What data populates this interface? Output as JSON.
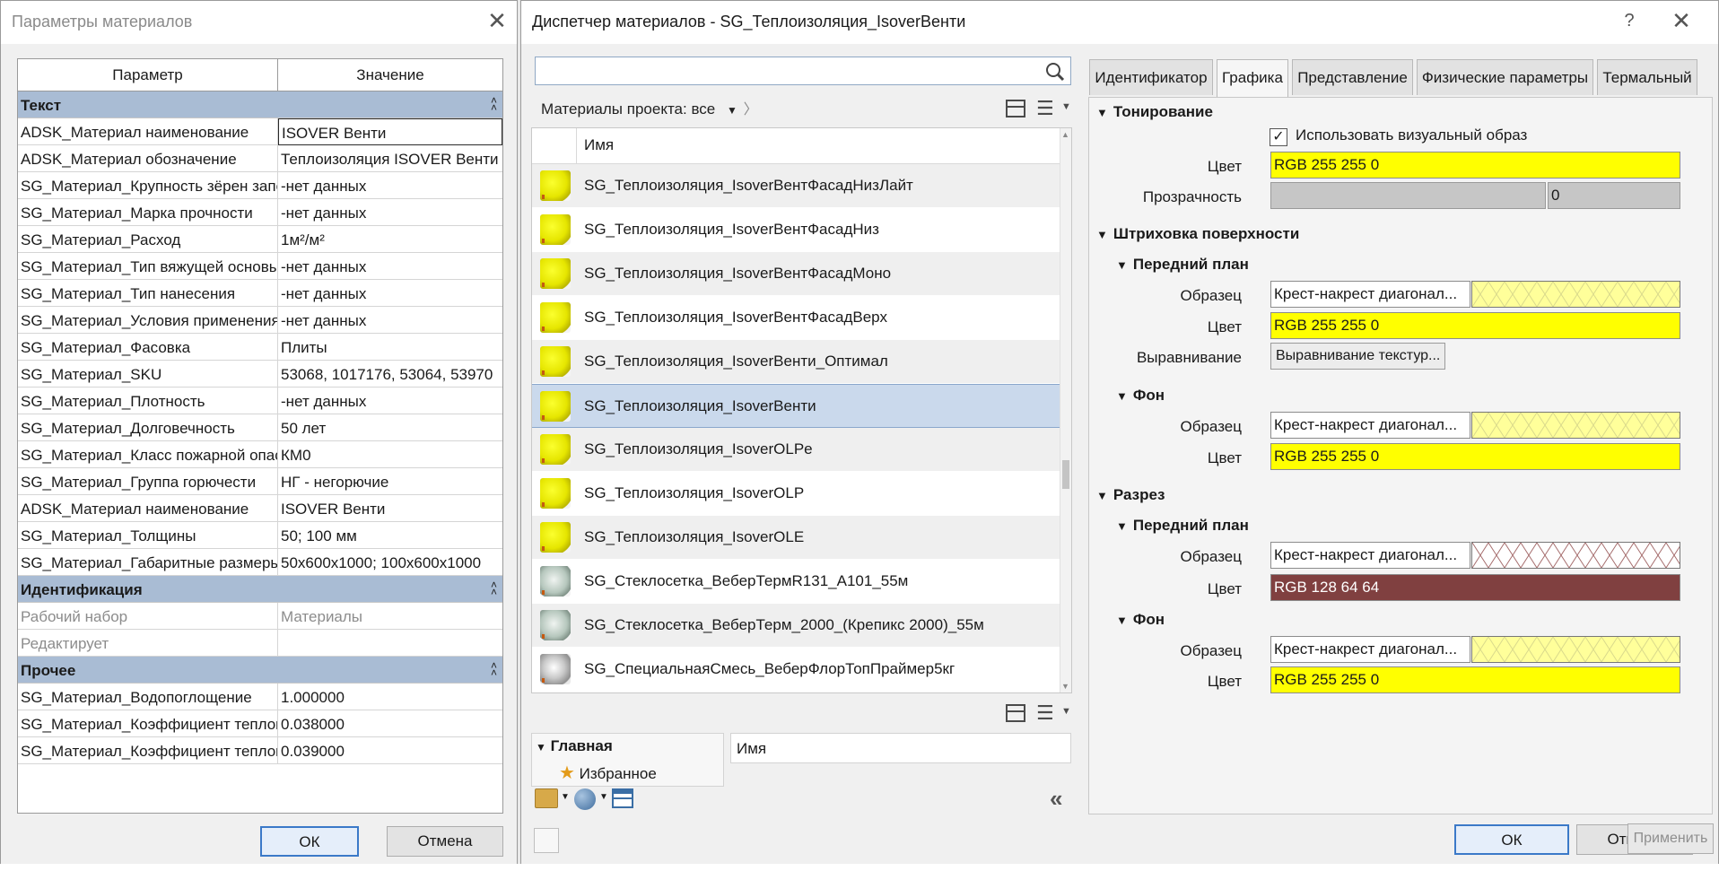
{
  "left_dialog": {
    "title": "Параметры материалов",
    "columns": [
      "Параметр",
      "Значение"
    ],
    "groups": [
      {
        "name": "Текст",
        "rows": [
          {
            "k": "ADSK_Материал наименование",
            "v": "ISOVER Венти"
          },
          {
            "k": "ADSK_Материал обозначение",
            "v": "Теплоизоляция ISOVER Венти"
          },
          {
            "k": "SG_Материал_Крупность зёрен запол",
            "v": "-нет данных"
          },
          {
            "k": "SG_Материал_Марка прочности",
            "v": "-нет данных"
          },
          {
            "k": "SG_Материал_Расход",
            "v": "1м²/м²"
          },
          {
            "k": "SG_Материал_Тип вяжущей основы",
            "v": "-нет данных"
          },
          {
            "k": "SG_Материал_Тип нанесения",
            "v": "-нет данных"
          },
          {
            "k": "SG_Материал_Условия применения",
            "v": "-нет данных"
          },
          {
            "k": "SG_Материал_Фасовка",
            "v": "Плиты"
          },
          {
            "k": "SG_Материал_SKU",
            "v": "53068, 1017176, 53064, 53970"
          },
          {
            "k": "SG_Материал_Плотность",
            "v": "-нет данных"
          },
          {
            "k": "SG_Материал_Долговечность",
            "v": "50 лет"
          },
          {
            "k": "SG_Материал_Класс пожарной опасности",
            "v": "КМ0"
          },
          {
            "k": "SG_Материал_Группа горючести",
            "v": "НГ - негорючие"
          },
          {
            "k": "ADSK_Материал наименование",
            "v": "ISOVER Венти"
          },
          {
            "k": "SG_Материал_Толщины",
            "v": "50; 100 мм"
          },
          {
            "k": "SG_Материал_Габаритные размеры",
            "v": "50x600x1000; 100x600x1000"
          }
        ]
      },
      {
        "name": "Идентификация",
        "rows": [
          {
            "k": "Рабочий набор",
            "v": "Материалы"
          },
          {
            "k": "Редактирует",
            "v": ""
          }
        ]
      },
      {
        "name": "Прочее",
        "rows": [
          {
            "k": "SG_Материал_Водопоглощение",
            "v": "1.000000"
          },
          {
            "k": "SG_Материал_Коэффициент теплопроводности",
            "v": "0.038000"
          },
          {
            "k": "SG_Материал_Коэффициент теплопроводности",
            "v": "0.039000"
          }
        ]
      }
    ],
    "ok_label": "ОК",
    "cancel_label": "Отмена"
  },
  "right_dialog": {
    "title": "Диспетчер материалов - SG_Теплоизоляция_IsoverВенти",
    "help_label": "?",
    "search_placeholder": "",
    "filter_label": "Материалы проекта: все",
    "list_header": "Имя",
    "materials": [
      {
        "name": "SG_Теплоизоляция_IsoverВентФасадНизЛайт",
        "swatch": "yellow"
      },
      {
        "name": "SG_Теплоизоляция_IsoverВентФасадНиз",
        "swatch": "yellow"
      },
      {
        "name": "SG_Теплоизоляция_IsoverВентФасадМоно",
        "swatch": "yellow"
      },
      {
        "name": "SG_Теплоизоляция_IsoverВентФасадВерх",
        "swatch": "yellow"
      },
      {
        "name": "SG_Теплоизоляция_IsoverВенти_Оптимал",
        "swatch": "yellow"
      },
      {
        "name": "SG_Теплоизоляция_IsoverВенти",
        "swatch": "yellow",
        "selected": true
      },
      {
        "name": "SG_Теплоизоляция_IsoverOLPe",
        "swatch": "yellow"
      },
      {
        "name": "SG_Теплоизоляция_IsoverOLP",
        "swatch": "yellow"
      },
      {
        "name": "SG_Теплоизоляция_IsoverOLE",
        "swatch": "yellow"
      },
      {
        "name": "SG_Стеклосетка_ВеберТермR131_A101_55м",
        "swatch": "mesh"
      },
      {
        "name": "SG_Стеклосетка_ВеберТерм_2000_(Крепикс 2000)_55м",
        "swatch": "mesh"
      },
      {
        "name": "SG_СпециальнаяСмесь_ВеберФлорТопПраймер5кг",
        "swatch": "grey"
      }
    ],
    "library": {
      "tree_root": "Главная",
      "tree_child": "Избранное",
      "name_header": "Имя"
    },
    "tabs": [
      "Идентификатор",
      "Графика",
      "Представление",
      "Физические параметры",
      "Термальный"
    ],
    "active_tab": "Графика",
    "graphics": {
      "shading": {
        "title": "Тонирование",
        "use_render_label": "Использовать визуальный образ",
        "use_render_checked": true,
        "color_label": "Цвет",
        "color_value": "RGB 255 255 0",
        "color_hex": "#ffff00",
        "transparency_label": "Прозрачность",
        "transparency_value": "0"
      },
      "surface_pattern": {
        "title": "Штриховка поверхности",
        "foreground": {
          "title": "Передний план",
          "pattern_label": "Образец",
          "pattern_value": "Крест-накрест диагонал...",
          "color_label": "Цвет",
          "color_value": "RGB 255 255 0",
          "color_hex": "#ffff00",
          "align_label": "Выравнивание",
          "align_button": "Выравнивание текстур..."
        },
        "background": {
          "title": "Фон",
          "pattern_label": "Образец",
          "pattern_value": "Крест-накрест диагонал...",
          "color_label": "Цвет",
          "color_value": "RGB 255 255 0",
          "color_hex": "#ffff00"
        }
      },
      "cut_pattern": {
        "title": "Разрез",
        "foreground": {
          "title": "Передний план",
          "pattern_label": "Образец",
          "pattern_value": "Крест-накрест диагонал...",
          "color_label": "Цвет",
          "color_value": "RGB 128 64 64",
          "color_hex": "#804040"
        },
        "background": {
          "title": "Фон",
          "pattern_label": "Образец",
          "pattern_value": "Крест-накрест диагонал...",
          "color_label": "Цвет",
          "color_value": "RGB 255 255 0",
          "color_hex": "#ffff00"
        }
      }
    },
    "ok_label": "ОК",
    "cancel_label": "Отмена",
    "apply_label": "Применить"
  }
}
